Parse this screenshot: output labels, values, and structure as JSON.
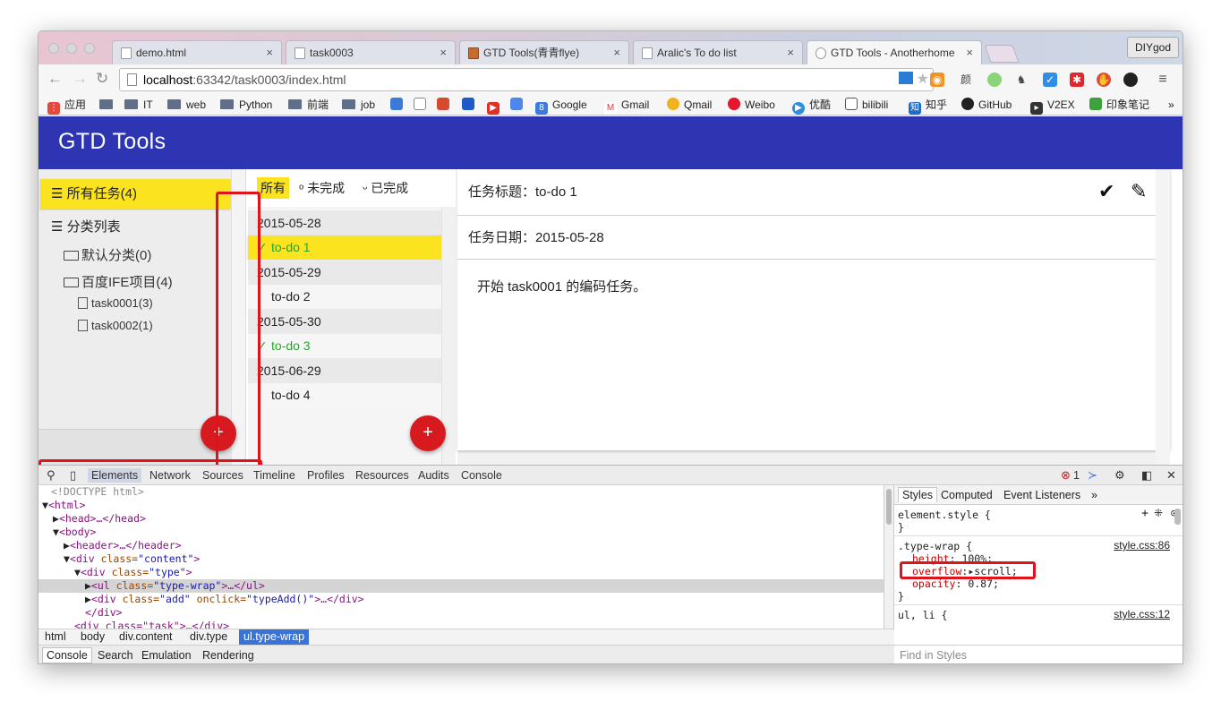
{
  "browser": {
    "tabs": [
      {
        "title": "demo.html"
      },
      {
        "title": "task0003"
      },
      {
        "title": "GTD Tools(青青flye)"
      },
      {
        "title": "Aralic's To do list"
      },
      {
        "title": "GTD Tools - Anotherhome"
      }
    ],
    "tab_close_glyph": "×",
    "profile": "DIYgod",
    "url_host": "localhost",
    "url_path": ":63342/task0003/index.html",
    "bookmarks": {
      "apps": "应用",
      "it": "IT",
      "web": "web",
      "python": "Python",
      "frontend": "前端",
      "job": "job",
      "google": "Google",
      "gmail": "Gmail",
      "qmail": "Qmail",
      "weibo": "Weibo",
      "youku": "优酷",
      "bilibili": "bilibili",
      "zhihu": "知乎",
      "github": "GitHub",
      "v2ex": "V2EX",
      "evernote": "印象笔记",
      "more": "»"
    }
  },
  "app": {
    "title": "GTD Tools",
    "categories": {
      "all": "所有任务(4)",
      "list_header": "分类列表",
      "default": "默认分类(0)",
      "ife": "百度IFE项目(4)",
      "task1": "task0001(3)",
      "task2": "task0002(1)"
    },
    "add_glyph": "+",
    "filters": {
      "all": "所有",
      "undone": "未完成",
      "done": "已完成"
    },
    "tasks": {
      "d1": "2015-05-28",
      "t1": "to-do 1",
      "d2": "2015-05-29",
      "t2": "to-do 2",
      "d3": "2015-05-30",
      "t3": "to-do 3",
      "d4": "2015-06-29",
      "t4": "to-do 4"
    },
    "detail": {
      "title": "任务标题：to-do 1",
      "date": "任务日期：2015-05-28",
      "content": "开始 task0001 的编码任务。"
    }
  },
  "devtools": {
    "tabs": {
      "elements": "Elements",
      "network": "Network",
      "sources": "Sources",
      "timeline": "Timeline",
      "profiles": "Profiles",
      "resources": "Resources",
      "audits": "Audits",
      "console": "Console"
    },
    "error_count": "1",
    "dom": {
      "doctype": "<!DOCTYPE html>",
      "html_open": "<html>",
      "head": "<head>…</head>",
      "body_open": "<body>",
      "header": "<header>…</header>",
      "content_tag": "<div ",
      "content_attr": "class=",
      "content_val": "\"content\"",
      "type_val": "\"type\"",
      "typewrap_tag": "<ul ",
      "typewrap_val": "\"type-wrap\"",
      "typewrap_rest": ">…</ul>",
      "add_val": "\"add\"",
      "onclick_attr": " onclick=",
      "onclick_val": "\"typeAdd()\"",
      "add_rest": ">…</div>",
      "div_close": "</div>",
      "task_line": "<div class=\"task\">…</div>"
    },
    "breadcrumbs": [
      "html",
      "body",
      "div.content",
      "div.type",
      "ul.type-wrap"
    ],
    "styles": {
      "tabs": [
        "Styles",
        "Computed",
        "Event Listeners"
      ],
      "more": "»",
      "element_style": "element.style {",
      "close_brace": "}",
      "selector": ".type-wrap {",
      "source1": "style.css:86",
      "height_prop": "height",
      "height_val": "100%;",
      "overflow_prop": "overflow",
      "overflow_val": "scroll;",
      "opacity_prop": "opacity",
      "opacity_val": "0.87;",
      "selector2": "ul, li {",
      "source2": "style.css:12",
      "find_placeholder": "Find in Styles"
    },
    "drawer_tabs": [
      "Console",
      "Search",
      "Emulation",
      "Rendering"
    ]
  }
}
